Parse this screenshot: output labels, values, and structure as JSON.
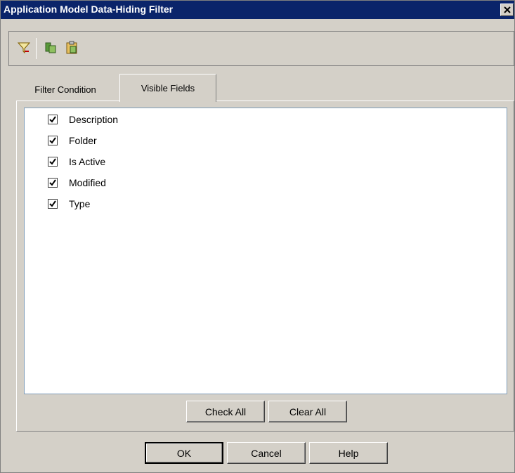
{
  "window": {
    "title": "Application Model Data-Hiding Filter"
  },
  "toolbar": {
    "icons": [
      "filter-icon",
      "copy-icon",
      "paste-icon"
    ]
  },
  "tabs": [
    {
      "label": "Filter Condition",
      "active": false
    },
    {
      "label": "Visible Fields",
      "active": true
    }
  ],
  "fields": [
    {
      "label": "Description",
      "checked": true
    },
    {
      "label": "Folder",
      "checked": true
    },
    {
      "label": "Is Active",
      "checked": true
    },
    {
      "label": "Modified",
      "checked": true
    },
    {
      "label": "Type",
      "checked": true
    }
  ],
  "list_buttons": {
    "check_all": "Check All",
    "clear_all": "Clear All"
  },
  "dialog_buttons": {
    "ok": "OK",
    "cancel": "Cancel",
    "help": "Help"
  },
  "colors": {
    "titlebar": "#0a246a",
    "face": "#d4d0c8",
    "list_border": "#7f9db9"
  }
}
